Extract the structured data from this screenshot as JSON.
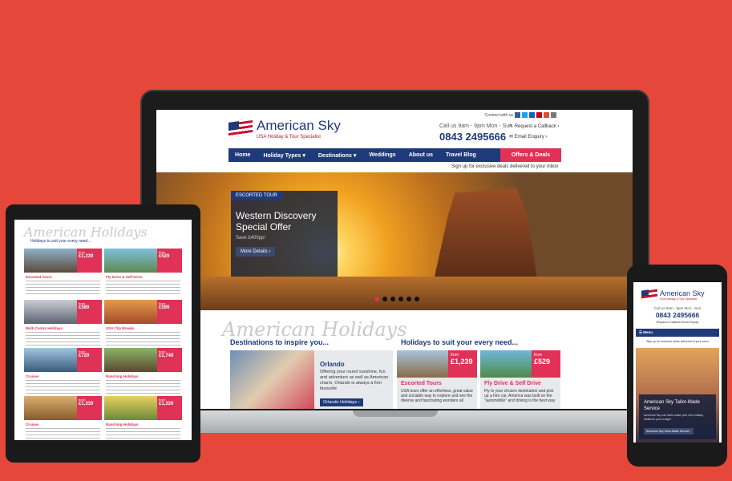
{
  "colors": {
    "background": "#e5473a",
    "brand_blue": "#1f3a7a",
    "accent_pink": "#e03156"
  },
  "laptop": {
    "header": {
      "logo_title": "American Sky",
      "logo_sub": "USA Holiday & Tour Specialist",
      "connect": "Connect with us",
      "call_hours": "Call us 9am - 9pm Mon - Sun",
      "phone": "0843 2495666",
      "callback": "Request a Callback",
      "email": "Email Enquiry"
    },
    "nav": {
      "items": [
        "Home",
        "Holiday Types",
        "Destinations",
        "Weddings",
        "About us",
        "Travel Blog"
      ],
      "offers": "Offers & Deals"
    },
    "signup": "Sign up for exclusive deals delivered to your inbox",
    "hero": {
      "tag": "ESCORTED TOUR",
      "title": "Western Discovery Special Offer",
      "price": "Save £400pp!",
      "button": "More Details"
    },
    "script_heading": "American Holidays",
    "destinations_title": "Destinations to inspire you...",
    "suit_title": "Holidays to suit your every need...",
    "destination": {
      "name": "Orlando",
      "desc": "Offering your round sunshine, fun and adventure as well as American charm, Orlando is always a firm favourite",
      "button": "Orlando Holidays"
    },
    "tours": [
      {
        "from": "from",
        "price": "£1,239",
        "name": "Escorted Tours",
        "desc": "USA tours offer an effortless, great value and sociable way to explore and see the diverse and fascinating wonders all"
      },
      {
        "from": "from",
        "price": "£529",
        "name": "Fly Drive & Self Drive",
        "desc": "Fly to your chosen destination and pick up a hire car. America was built on the \"automobile\" and driving is the best way"
      }
    ]
  },
  "tablet": {
    "script_heading": "American Holidays",
    "sub": "Holidays to suit your every need...",
    "cards": [
      {
        "name": "Escorted Tours",
        "from": "from",
        "price": "£1,239"
      },
      {
        "name": "Fly Drive & Self Drive",
        "from": "from",
        "price": "£529"
      },
      {
        "name": "Multi Centre Holidays",
        "from": "from",
        "price": "£589"
      },
      {
        "name": "USA City Breaks",
        "from": "from",
        "price": "£599"
      },
      {
        "name": "Cruises",
        "from": "from",
        "price": "£729"
      },
      {
        "name": "Ranching Holidays",
        "from": "from",
        "price": "£1,749"
      },
      {
        "name": "Cruises",
        "from": "from",
        "price": "£1,339"
      },
      {
        "name": "Ranching Holidays",
        "from": "from",
        "price": "£1,339"
      }
    ]
  },
  "phone": {
    "logo_title": "American Sky",
    "logo_sub": "USA Holiday & Tour Specialist",
    "call_hours": "Call us 9am - 9pm Mon - Sun",
    "phone": "0843 2495666",
    "links": "Request a Callback  Email Enquiry",
    "menu": "Menu",
    "signup": "Sign up for exclusive deals delivered to your inbox",
    "hero_title": "American Sky Tailor-Made Service",
    "hero_desc": "American Sky can tailor-make your next holiday, whatever your budget",
    "hero_button": "American Sky Tailor-Made Service"
  }
}
